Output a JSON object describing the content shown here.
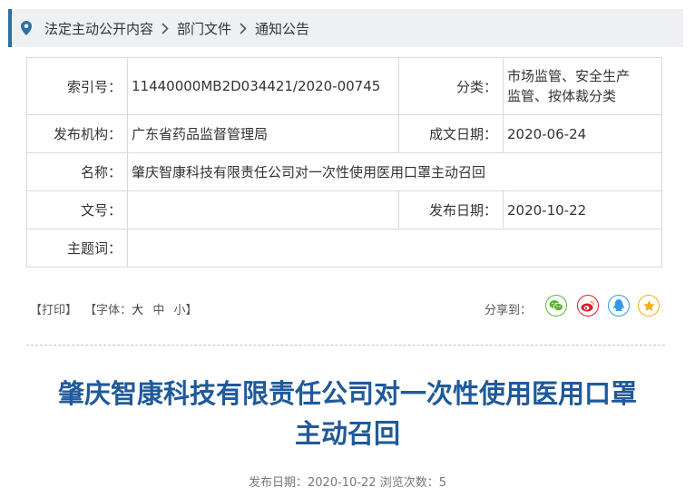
{
  "breadcrumb": {
    "items": [
      "法定主动公开内容",
      "部门文件",
      "通知公告"
    ]
  },
  "info": {
    "index_label": "索引号：",
    "index_value": "11440000MB2D034421/2020-00745",
    "category_label": "分类：",
    "category_value_line1": "市场监管、安全生产",
    "category_value_line2": "监管、按体裁分类",
    "publisher_label": "发布机构：",
    "publisher_value": "广东省药品监督管理局",
    "created_label": "成文日期：",
    "created_value": "2020-06-24",
    "name_label": "名称：",
    "name_value": "肇庆智康科技有限责任公司对一次性使用医用口罩主动召回",
    "docno_label": "文号：",
    "docno_value": "",
    "published_label": "发布日期：",
    "published_value": "2020-10-22",
    "subject_label": "主题词：",
    "subject_value": ""
  },
  "tools": {
    "print": "【打印】",
    "font_prefix": "【字体：",
    "font_large": "大",
    "font_medium": "中",
    "font_small": "小",
    "font_suffix": "】",
    "share_label": "分享到："
  },
  "share": {
    "icons": [
      "wechat-icon",
      "weibo-icon",
      "qq-icon",
      "qzone-icon"
    ],
    "colors": {
      "wechat": "#5bb531",
      "weibo": "#e6162d",
      "qq": "#2f9be8",
      "qzone": "#f2b01e"
    }
  },
  "article": {
    "title_line1": "肇庆智康科技有限责任公司对一次性使用医用口罩",
    "title_line2": "主动召回",
    "meta": "发布日期：2020-10-22  浏览次数：5"
  },
  "colors": {
    "accent": "#2f6ea7",
    "title": "#1f5a9b",
    "border": "#d5dbe3"
  }
}
